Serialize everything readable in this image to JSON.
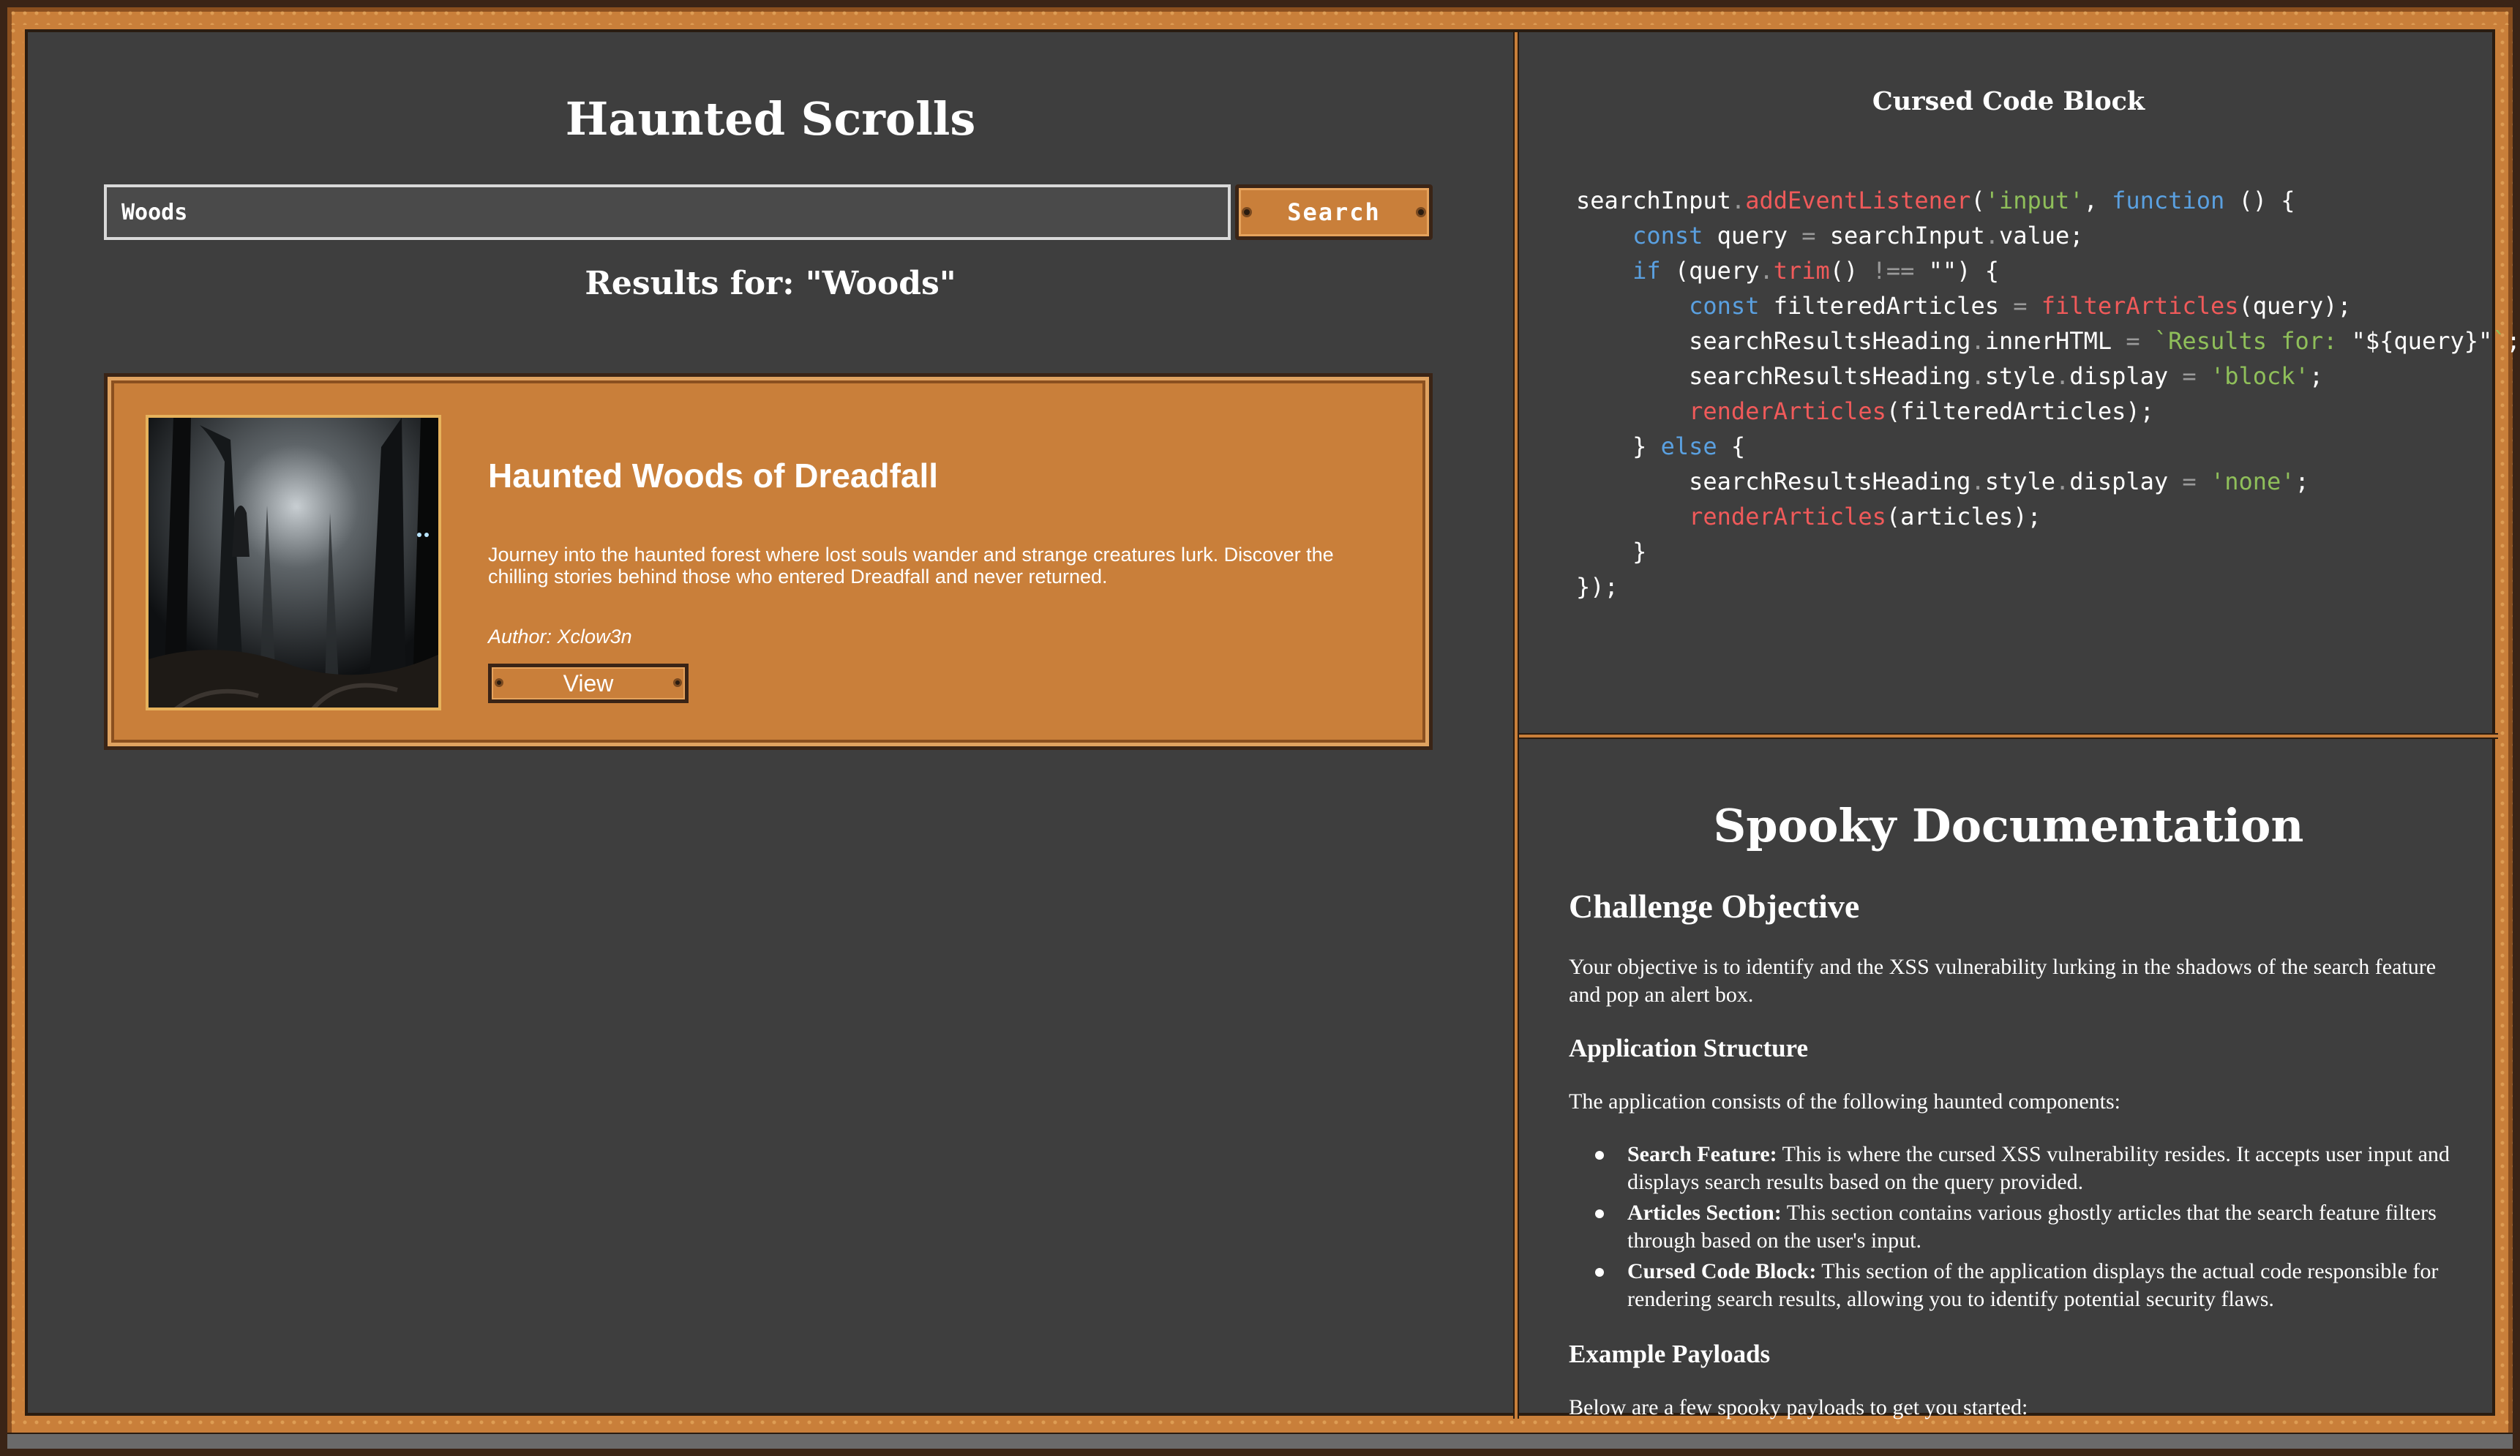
{
  "app": {
    "title": "Haunted Scrolls"
  },
  "search": {
    "value": "Woods",
    "button_label": "Search"
  },
  "results": {
    "heading": "Results for: \"Woods\""
  },
  "articles": [
    {
      "title": "Haunted Woods of Dreadfall",
      "description": "Journey into the haunted forest where lost souls wander and strange creatures lurk. Discover the chilling stories behind those who entered Dreadfall and never returned.",
      "author": "Author: Xclow3n",
      "button_label": "View"
    }
  ],
  "code_panel": {
    "title": "Cursed Code Block",
    "lines": [
      [
        {
          "t": "searchInput"
        },
        {
          "t": ".",
          "c": "op"
        },
        {
          "t": "addEventListener",
          "c": "fn"
        },
        {
          "t": "("
        },
        {
          "t": "'input'",
          "c": "str"
        },
        {
          "t": ", "
        },
        {
          "t": "function",
          "c": "kw"
        },
        {
          "t": " () {"
        }
      ],
      [
        {
          "t": "    "
        },
        {
          "t": "const",
          "c": "kw"
        },
        {
          "t": " query "
        },
        {
          "t": "=",
          "c": "op"
        },
        {
          "t": " searchInput"
        },
        {
          "t": ".",
          "c": "op"
        },
        {
          "t": "value"
        },
        {
          "t": ";"
        }
      ],
      [
        {
          "t": "    "
        },
        {
          "t": "if",
          "c": "kw"
        },
        {
          "t": " (query"
        },
        {
          "t": ".",
          "c": "op"
        },
        {
          "t": "trim",
          "c": "fn"
        },
        {
          "t": "() "
        },
        {
          "t": "!==",
          "c": "op"
        },
        {
          "t": " \"\") {"
        }
      ],
      [
        {
          "t": "        "
        },
        {
          "t": "const",
          "c": "kw"
        },
        {
          "t": " filteredArticles "
        },
        {
          "t": "=",
          "c": "op"
        },
        {
          "t": " "
        },
        {
          "t": "filterArticles",
          "c": "fn"
        },
        {
          "t": "(query);"
        }
      ],
      [
        {
          "t": "        searchResultsHeading"
        },
        {
          "t": ".",
          "c": "op"
        },
        {
          "t": "innerHTML "
        },
        {
          "t": "=",
          "c": "op"
        },
        {
          "t": " "
        },
        {
          "t": "`Results for: ",
          "c": "str"
        },
        {
          "t": "\"${query}\""
        },
        {
          "t": "`",
          "c": "str"
        },
        {
          "t": ";"
        }
      ],
      [
        {
          "t": "        searchResultsHeading"
        },
        {
          "t": ".",
          "c": "op"
        },
        {
          "t": "style"
        },
        {
          "t": ".",
          "c": "op"
        },
        {
          "t": "display "
        },
        {
          "t": "=",
          "c": "op"
        },
        {
          "t": " "
        },
        {
          "t": "'block'",
          "c": "str"
        },
        {
          "t": ";"
        }
      ],
      [
        {
          "t": "        "
        },
        {
          "t": "renderArticles",
          "c": "fn"
        },
        {
          "t": "(filteredArticles);"
        }
      ],
      [
        {
          "t": "    } "
        },
        {
          "t": "else",
          "c": "kw"
        },
        {
          "t": " {"
        }
      ],
      [
        {
          "t": "        searchResultsHeading"
        },
        {
          "t": ".",
          "c": "op"
        },
        {
          "t": "style"
        },
        {
          "t": ".",
          "c": "op"
        },
        {
          "t": "display "
        },
        {
          "t": "=",
          "c": "op"
        },
        {
          "t": " "
        },
        {
          "t": "'none'",
          "c": "str"
        },
        {
          "t": ";"
        }
      ],
      [
        {
          "t": "        "
        },
        {
          "t": "renderArticles",
          "c": "fn"
        },
        {
          "t": "(articles);"
        }
      ],
      [
        {
          "t": "    }"
        }
      ],
      [
        {
          "t": "});"
        }
      ]
    ]
  },
  "docs": {
    "title": "Spooky Documentation",
    "objective_heading": "Challenge Objective",
    "objective_text": "Your objective is to identify and the XSS vulnerability lurking in the shadows of the search feature and pop an alert box.",
    "structure_heading": "Application Structure",
    "structure_intro": "The application consists of the following haunted components:",
    "components": [
      {
        "name": "Search Feature:",
        "text": " This is where the cursed XSS vulnerability resides. It accepts user input and displays search results based on the query provided."
      },
      {
        "name": "Articles Section:",
        "text": " This section contains various ghostly articles that the search feature filters through based on the user's input."
      },
      {
        "name": "Cursed Code Block:",
        "text": " This section of the application displays the actual code responsible for rendering search results, allowing you to identify potential security flaws."
      }
    ],
    "payloads_heading": "Example Payloads",
    "payloads_intro": "Below are a few spooky payloads to get you started:"
  },
  "icons": {
    "rivet": "rivet-icon",
    "bullet": "bullet-icon",
    "thumbnail": "haunted-forest-image"
  },
  "colors": {
    "wood": "#c97f3a",
    "wood_dark": "#3a2416",
    "panel_bg": "#3e3e3e",
    "code_function": "#f05a5a",
    "code_string": "#8fbf5a",
    "code_keyword": "#5aa0e0"
  }
}
